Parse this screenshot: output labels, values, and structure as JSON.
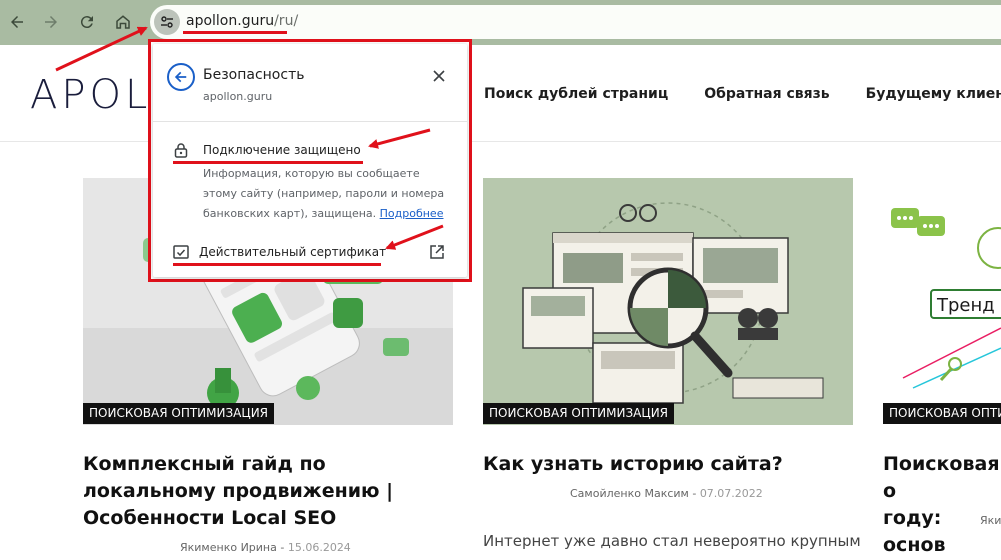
{
  "browser": {
    "back_icon": "arrow-left-icon",
    "forward_icon": "arrow-right-icon",
    "reload_icon": "reload-icon",
    "home_icon": "home-icon",
    "site_info_icon": "tune-icon",
    "url_host": "apollon.guru",
    "url_path": "/ru/"
  },
  "site": {
    "logo": "APOL",
    "nav": [
      "Поиск дублей страниц",
      "Обратная связь",
      "Будущему клиенту"
    ]
  },
  "popup": {
    "title": "Безопасность",
    "host": "apollon.guru",
    "connection_label": "Подключение защищено",
    "connection_desc": "Информация, которую вы сообщаете этому сайту (например, пароли и номера банковских карт), защищена.",
    "learn_more": "Подробнее",
    "certificate_label": "Действительный сертификат"
  },
  "cards": [
    {
      "badge": "ПОИСКОВАЯ ОПТИМИЗАЦИЯ",
      "title": "Комплексный гайд по локальному продвижению | Особенности Local SEO",
      "author": "Якименко Ирина",
      "date": "15.06.2024",
      "excerpt": ""
    },
    {
      "badge": "ПОИСКОВАЯ ОПТИМИЗАЦИЯ",
      "title": "Как узнать историю сайта?",
      "author": "Самойленко Максим",
      "date": "07.07.2022",
      "excerpt": "Интернет уже давно стал невероятно крупным"
    },
    {
      "badge": "ПОИСКОВАЯ ОПТИМИЗАЦИЯ",
      "title": "Поисковая о году: основ",
      "author": "Яки",
      "date": "",
      "excerpt": ""
    }
  ],
  "colors": {
    "chrome_bg": "#a9bba2",
    "annotation_red": "#e0111b",
    "link_blue": "#1a5fc8",
    "badge_bg": "#111111"
  }
}
